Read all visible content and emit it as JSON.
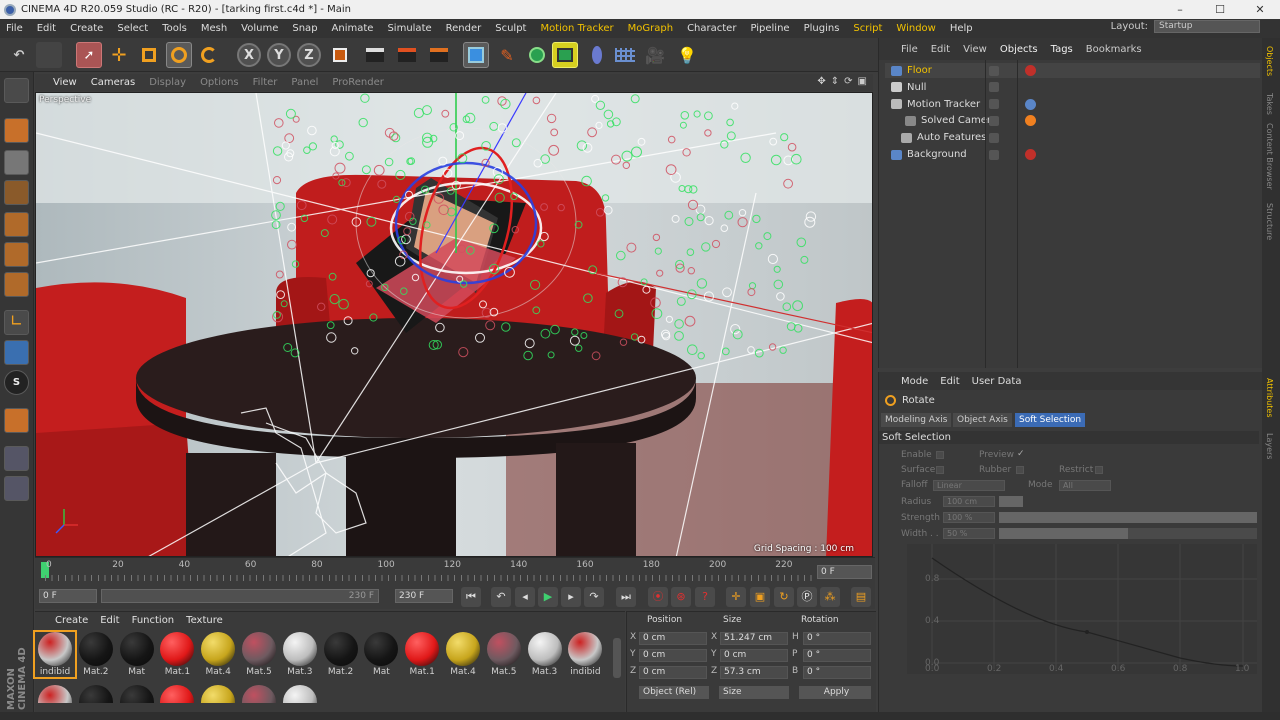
{
  "window": {
    "title": "CINEMA 4D R20.059 Studio (RC - R20) - [tarking first.c4d *] - Main",
    "controls": [
      "–",
      "☐",
      "✕"
    ]
  },
  "menubar": {
    "items": [
      "File",
      "Edit",
      "Create",
      "Select",
      "Tools",
      "Mesh",
      "Volume",
      "Snap",
      "Animate",
      "Simulate",
      "Render",
      "Sculpt",
      "Motion Tracker",
      "MoGraph",
      "Character",
      "Pipeline",
      "Plugins",
      "Script",
      "Window",
      "Help"
    ],
    "highlighted": [
      "Motion Tracker",
      "MoGraph",
      "Script",
      "Window"
    ],
    "layout_label": "Layout:",
    "layout_value": "Startup"
  },
  "toolbar": {
    "axis_x": "X",
    "axis_y": "Y",
    "axis_z": "Z"
  },
  "viewport": {
    "menu": [
      "View",
      "Cameras",
      "Display",
      "Options",
      "Filter",
      "Panel",
      "ProRender"
    ],
    "active_menu": [
      "View",
      "Cameras"
    ],
    "label": "Perspective",
    "grid_spacing": "Grid Spacing : 100 cm"
  },
  "timeline": {
    "ticks": [
      "0",
      "20",
      "40",
      "60",
      "80",
      "100",
      "120",
      "140",
      "160",
      "180",
      "200",
      "220"
    ],
    "current_frame_field": "0 F",
    "start_field": "0 F",
    "range_end_label": "230 F",
    "end_field": "230 F"
  },
  "material_manager": {
    "tabs": [
      "Create",
      "Edit",
      "Function",
      "Texture"
    ],
    "materials": [
      {
        "name": "indibid",
        "color": "#c8c8c8",
        "accent": "#cc2222"
      },
      {
        "name": "Mat.2",
        "color": "#151515",
        "accent": "#3a3a3a"
      },
      {
        "name": "Mat",
        "color": "#151515",
        "accent": "#3a3a3a"
      },
      {
        "name": "Mat.1",
        "color": "#e01818",
        "accent": "#ff6060"
      },
      {
        "name": "Mat.4",
        "color": "#c7a51c",
        "accent": "#f2dc6a"
      },
      {
        "name": "Mat.5",
        "color": "#6e5a60",
        "accent": "#c05060"
      },
      {
        "name": "Mat.3",
        "color": "#bdbdbd",
        "accent": "#f4f4f4"
      },
      {
        "name": "Mat.2",
        "color": "#151515",
        "accent": "#3a3a3a"
      },
      {
        "name": "Mat",
        "color": "#151515",
        "accent": "#3a3a3a"
      },
      {
        "name": "Mat.1",
        "color": "#e01818",
        "accent": "#ff6060"
      },
      {
        "name": "Mat.4",
        "color": "#c7a51c",
        "accent": "#f2dc6a"
      },
      {
        "name": "Mat.5",
        "color": "#6e5a60",
        "accent": "#c05060"
      },
      {
        "name": "Mat.3",
        "color": "#bdbdbd",
        "accent": "#f4f4f4"
      },
      {
        "name": "indibid",
        "color": "#c8c8c8",
        "accent": "#cc2222"
      }
    ],
    "brand": "MAXON CINEMA 4D"
  },
  "coordinates": {
    "headers": [
      "Position",
      "Size",
      "Rotation"
    ],
    "rows": [
      {
        "axis": "X",
        "pos": "0 cm",
        "size_axis": "X",
        "size": "51.247 cm",
        "rot_axis": "H",
        "rot": "0 °"
      },
      {
        "axis": "Y",
        "pos": "0 cm",
        "size_axis": "Y",
        "size": "0 cm",
        "rot_axis": "P",
        "rot": "0 °"
      },
      {
        "axis": "Z",
        "pos": "0 cm",
        "size_axis": "Z",
        "size": "57.3 cm",
        "rot_axis": "B",
        "rot": "0 °"
      }
    ],
    "mode": "Object (Rel)",
    "size_mode": "Size",
    "apply": "Apply"
  },
  "object_manager": {
    "menu": [
      "File",
      "Edit",
      "View",
      "Objects",
      "Tags",
      "Bookmarks"
    ],
    "objects": [
      {
        "name": "Floor",
        "selected": true,
        "icon_color": "#5a86c8"
      },
      {
        "name": "Null",
        "selected": false,
        "icon_color": "#cccccc"
      },
      {
        "name": "Motion Tracker",
        "selected": false,
        "icon_color": "#bbbbbb"
      },
      {
        "name": "Solved Camera",
        "selected": false,
        "icon_color": "#888888"
      },
      {
        "name": "Auto Features",
        "selected": false,
        "icon_color": "#aaaaaa"
      },
      {
        "name": "Background",
        "selected": false,
        "icon_color": "#5a86c8"
      }
    ]
  },
  "attributes": {
    "menu": [
      "Mode",
      "Edit",
      "User Data"
    ],
    "tool_name": "Rotate",
    "tabs": [
      "Modeling Axis",
      "Object Axis",
      "Soft Selection"
    ],
    "active_tab": "Soft Selection",
    "section": "Soft Selection",
    "labels": {
      "enable": "Enable",
      "preview": "Preview",
      "preview_mark": "✓",
      "surface": "Surface",
      "rubber": "Rubber",
      "restrict": "Restrict",
      "falloff": "Falloff",
      "falloff_value": "Linear",
      "mode": "Mode",
      "mode_value": "All",
      "radius": "Radius",
      "radius_value": "100 cm",
      "strength": "Strength",
      "strength_value": "100 %",
      "width": "Width . .",
      "width_value": "50 %"
    },
    "graph_x": [
      "0.0",
      "0.2",
      "0.4",
      "0.6",
      "0.8",
      "1.0"
    ],
    "graph_y": [
      "0.8",
      "0.4",
      "0.0"
    ]
  },
  "right_tabs": [
    "Objects",
    "Takes",
    "Content Browser",
    "Structure",
    "Attributes",
    "Layers"
  ]
}
